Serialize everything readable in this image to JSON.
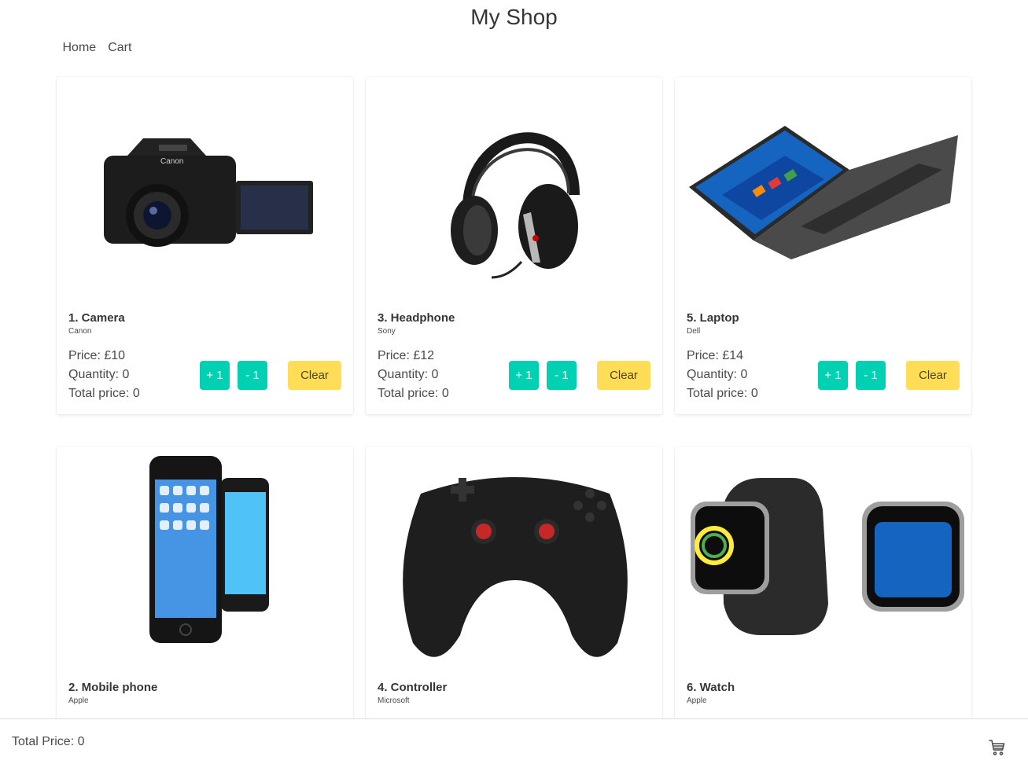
{
  "header": {
    "title": "My Shop"
  },
  "nav": {
    "home": "Home",
    "cart": "Cart"
  },
  "labels": {
    "price_prefix": "Price: £",
    "quantity_prefix": "Quantity: ",
    "total_prefix": "Total price: ",
    "inc": "+ 1",
    "dec": "- 1",
    "clear": "Clear"
  },
  "products": [
    {
      "name": "1. Camera",
      "brand": "Canon",
      "price": "Price: £10",
      "quantity": "Quantity: 0",
      "total": "Total price: 0",
      "image_icon": "camera-image"
    },
    {
      "name": "3. Headphone",
      "brand": "Sony",
      "price": "Price: £12",
      "quantity": "Quantity: 0",
      "total": "Total price: 0",
      "image_icon": "headphone-image"
    },
    {
      "name": "5. Laptop",
      "brand": "Dell",
      "price": "Price: £14",
      "quantity": "Quantity: 0",
      "total": "Total price: 0",
      "image_icon": "laptop-image"
    },
    {
      "name": "2. Mobile phone",
      "brand": "Apple",
      "image_icon": "mobile-phone-image"
    },
    {
      "name": "4. Controller",
      "brand": "Microsoft",
      "image_icon": "controller-image"
    },
    {
      "name": "6. Watch",
      "brand": "Apple",
      "image_icon": "watch-image"
    }
  ],
  "footer": {
    "total_price": "Total Price: 0",
    "cart_icon": "cart-icon"
  },
  "colors": {
    "primary": "#00d1b2",
    "warning": "#ffdd57",
    "text": "#4a4a4a"
  }
}
